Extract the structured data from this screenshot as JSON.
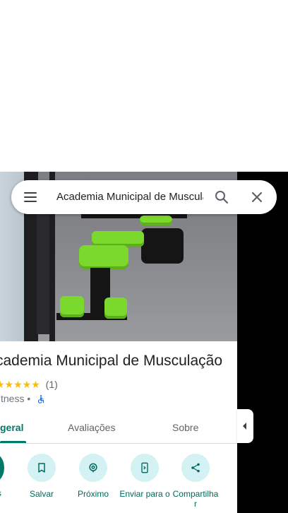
{
  "search": {
    "query": "Academia Municipal de Musculação"
  },
  "place": {
    "title": "Academia Municipal de Musculação",
    "rating_count": "(1)",
    "category": "fitness •",
    "stars": "★★★★★"
  },
  "tabs": [
    {
      "label": "geral",
      "active": true
    },
    {
      "label": "Avaliações",
      "active": false
    },
    {
      "label": "Sobre",
      "active": false
    }
  ],
  "actions": [
    {
      "label": "s",
      "icon": "directions-icon"
    },
    {
      "label": "Salvar",
      "icon": "bookmark-icon"
    },
    {
      "label": "Próximo",
      "icon": "nearby-icon"
    },
    {
      "label": "Enviar para o",
      "icon": "send-to-phone-icon"
    },
    {
      "label": "Compartilha r",
      "icon": "share-icon"
    }
  ],
  "colors": {
    "accent": "#00796b",
    "action_bg": "#d4f1f4",
    "star": "#fbbc04",
    "equipment_pad": "#7bd82c"
  }
}
